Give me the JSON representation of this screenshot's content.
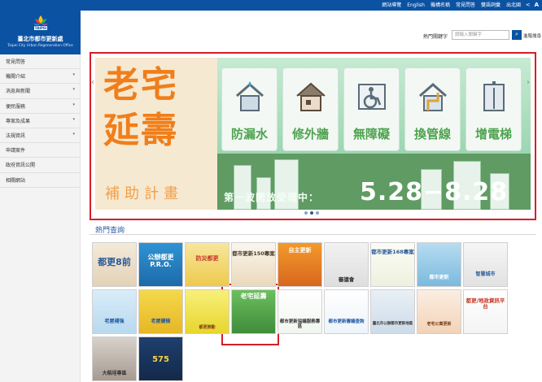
{
  "top_nav": {
    "links": [
      "網站導覽",
      "English",
      "機構名稱",
      "常見問答",
      "雙語詞彙",
      "出北國"
    ],
    "share_icon": "share-icon",
    "font_size_label": "A"
  },
  "logo": {
    "brand": "TAIPEI",
    "name_zh": "臺北市都市更新處",
    "name_en": "Taipei City Urban Regeneration Office"
  },
  "sidebar": {
    "items": [
      {
        "label": "常見問答",
        "has_children": false
      },
      {
        "label": "機關介紹",
        "has_children": true
      },
      {
        "label": "消息與新聞",
        "has_children": true
      },
      {
        "label": "便民服務",
        "has_children": true
      },
      {
        "label": "專案及成果",
        "has_children": true
      },
      {
        "label": "法規資訊",
        "has_children": true
      },
      {
        "label": "申請案件",
        "has_children": false
      },
      {
        "label": "政府資訊公開",
        "has_children": false
      },
      {
        "label": "相關網站",
        "has_children": false
      }
    ]
  },
  "search": {
    "label": "熱門關鍵字",
    "placeholder": "請輸入關鍵字",
    "advanced_label": "進階搜尋"
  },
  "banner": {
    "title_line1": "老宅",
    "title_line2": "延壽",
    "subtitle": "補助計畫",
    "items": [
      "防漏水",
      "修外牆",
      "無障礙",
      "換管線",
      "增電梯"
    ],
    "wave_text": "第一波開放受理中：",
    "dates": "5.28−8.28",
    "slide_count": 3,
    "active_slide": 2
  },
  "hot": {
    "title": "熱門查詢",
    "tiles": [
      {
        "text": "都更8前"
      },
      {
        "text": "公辦都更P.R.O."
      },
      {
        "text": "防災都更"
      },
      {
        "text": "都市更新150專案"
      },
      {
        "text": "自主更新"
      },
      {
        "text": "審議會"
      },
      {
        "text": "都市更新168專案"
      },
      {
        "text": "都市更新"
      },
      {
        "text": "智慧城市"
      },
      {
        "text": "老屋補強"
      },
      {
        "text": "老屋健檢"
      },
      {
        "text": "都更推動"
      },
      {
        "text": "老宅延壽"
      },
      {
        "text": "都市更新協議服務專區"
      },
      {
        "text": "都市更新審議查詢"
      },
      {
        "text": "臺北市公辦都市更新地區"
      },
      {
        "text": "老宅公寓更新"
      },
      {
        "text": "都更/地政資訊平台"
      },
      {
        "text": "大稻埕專區"
      },
      {
        "text": "575"
      }
    ]
  },
  "colors": {
    "brand_blue": "#0b52a3",
    "highlight_red": "#d51f2a",
    "banner_orange": "#f07e1a",
    "banner_green": "#4ea34f"
  }
}
